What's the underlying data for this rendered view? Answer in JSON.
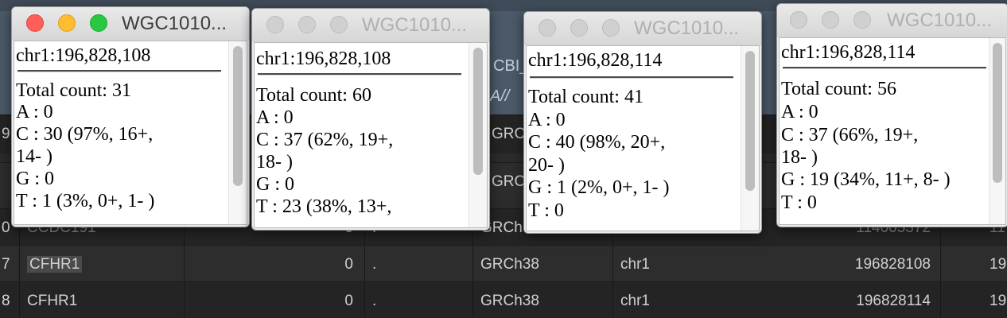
{
  "background_table": {
    "header_fragments": {
      "col_a": "CBI_",
      "col_b": "A//"
    },
    "partial_rows": [
      {
        "rownum": "9",
        "assembly": "GRCh"
      },
      {
        "rownum": "",
        "assembly": "GRCh"
      }
    ],
    "rows": [
      {
        "rownum": "0",
        "gene": "CCDC191",
        "count": "0",
        "dot": ".",
        "assembly": "GRCh",
        "chrom": "",
        "position": "114005372",
        "extra": "11"
      },
      {
        "rownum": "7",
        "gene": "CFHR1",
        "count": "0",
        "dot": ".",
        "assembly": "GRCh38",
        "chrom": "chr1",
        "position": "196828108",
        "extra": "19"
      },
      {
        "rownum": "8",
        "gene": "CFHR1",
        "count": "0",
        "dot": ".",
        "assembly": "GRCh38",
        "chrom": "chr1",
        "position": "196828114",
        "extra": "19"
      }
    ]
  },
  "windows": [
    {
      "title": "WGC1010...",
      "active": true,
      "locus": "chr1:196,828,108",
      "lines": [
        "Total count: 31",
        "A : 0",
        "C : 30 (97%, 16+,",
        "14- )",
        "G : 0",
        "T : 1 (3%, 0+, 1- )"
      ]
    },
    {
      "title": "WGC1010...",
      "active": false,
      "locus": "chr1:196,828,108",
      "lines": [
        "Total count: 60",
        "A : 0",
        "C : 37 (62%, 19+,",
        "18- )",
        "G : 0",
        "T : 23 (38%, 13+,"
      ]
    },
    {
      "title": "WGC1010...",
      "active": false,
      "locus": "chr1:196,828,114",
      "lines": [
        "Total count: 41",
        "A : 0",
        "C : 40 (98%, 20+,",
        "20- )",
        "G : 1 (2%, 0+, 1- )",
        "T : 0"
      ]
    },
    {
      "title": "WGC1010...",
      "active": false,
      "locus": "chr1:196,828,114",
      "lines": [
        "Total count: 56",
        "A : 0",
        "C : 37 (66%, 19+,",
        "18- )",
        "G : 19 (34%, 11+, 8- )",
        "T : 0"
      ]
    }
  ],
  "colors": {
    "traffic_red": "#fe5f57",
    "traffic_yellow": "#febc2e",
    "traffic_green": "#28c840"
  }
}
